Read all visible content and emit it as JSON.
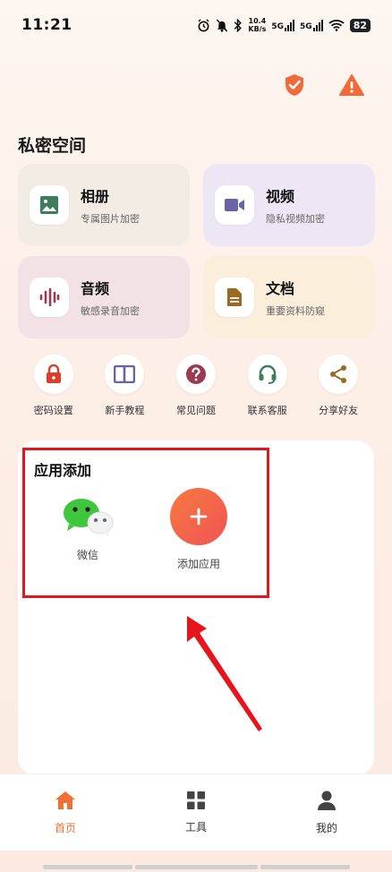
{
  "status_bar": {
    "time": "11:21",
    "net_speed_value": "10.4",
    "net_speed_unit": "KB/s",
    "sig1_label": "5G",
    "sig2_label": "5G",
    "battery": "82"
  },
  "colors": {
    "accent": "#f07133",
    "warning": "#f26a3a",
    "highlight": "#e8141c"
  },
  "section": {
    "title": "私密空间"
  },
  "cards": [
    {
      "title": "相册",
      "subtitle": "专属图片加密",
      "icon": "image-icon",
      "bg": "#f3ece4",
      "icon_color": "#3d7d5e"
    },
    {
      "title": "视频",
      "subtitle": "隐私视频加密",
      "icon": "video-camera-icon",
      "bg": "#ede6f5",
      "icon_color": "#6a63a8"
    },
    {
      "title": "音频",
      "subtitle": "敏感录音加密",
      "icon": "audio-wave-icon",
      "bg": "#f2e2e6",
      "icon_color": "#9b3a50"
    },
    {
      "title": "文档",
      "subtitle": "重要资料防窥",
      "icon": "document-icon",
      "bg": "#fbefdb",
      "icon_color": "#9a6a22"
    }
  ],
  "tools": [
    {
      "label": "密码设置",
      "icon": "lock-icon"
    },
    {
      "label": "新手教程",
      "icon": "book-icon"
    },
    {
      "label": "常见问题",
      "icon": "question-icon"
    },
    {
      "label": "联系客服",
      "icon": "headset-icon"
    },
    {
      "label": "分享好友",
      "icon": "share-icon"
    }
  ],
  "app_add": {
    "title": "应用添加",
    "apps": [
      {
        "label": "微信",
        "icon": "wechat-icon"
      },
      {
        "label": "添加应用",
        "icon": "plus-icon"
      }
    ]
  },
  "nav": [
    {
      "label": "首页",
      "icon": "home-icon",
      "active": true
    },
    {
      "label": "工具",
      "icon": "grid-icon",
      "active": false
    },
    {
      "label": "我的",
      "icon": "user-icon",
      "active": false
    }
  ]
}
